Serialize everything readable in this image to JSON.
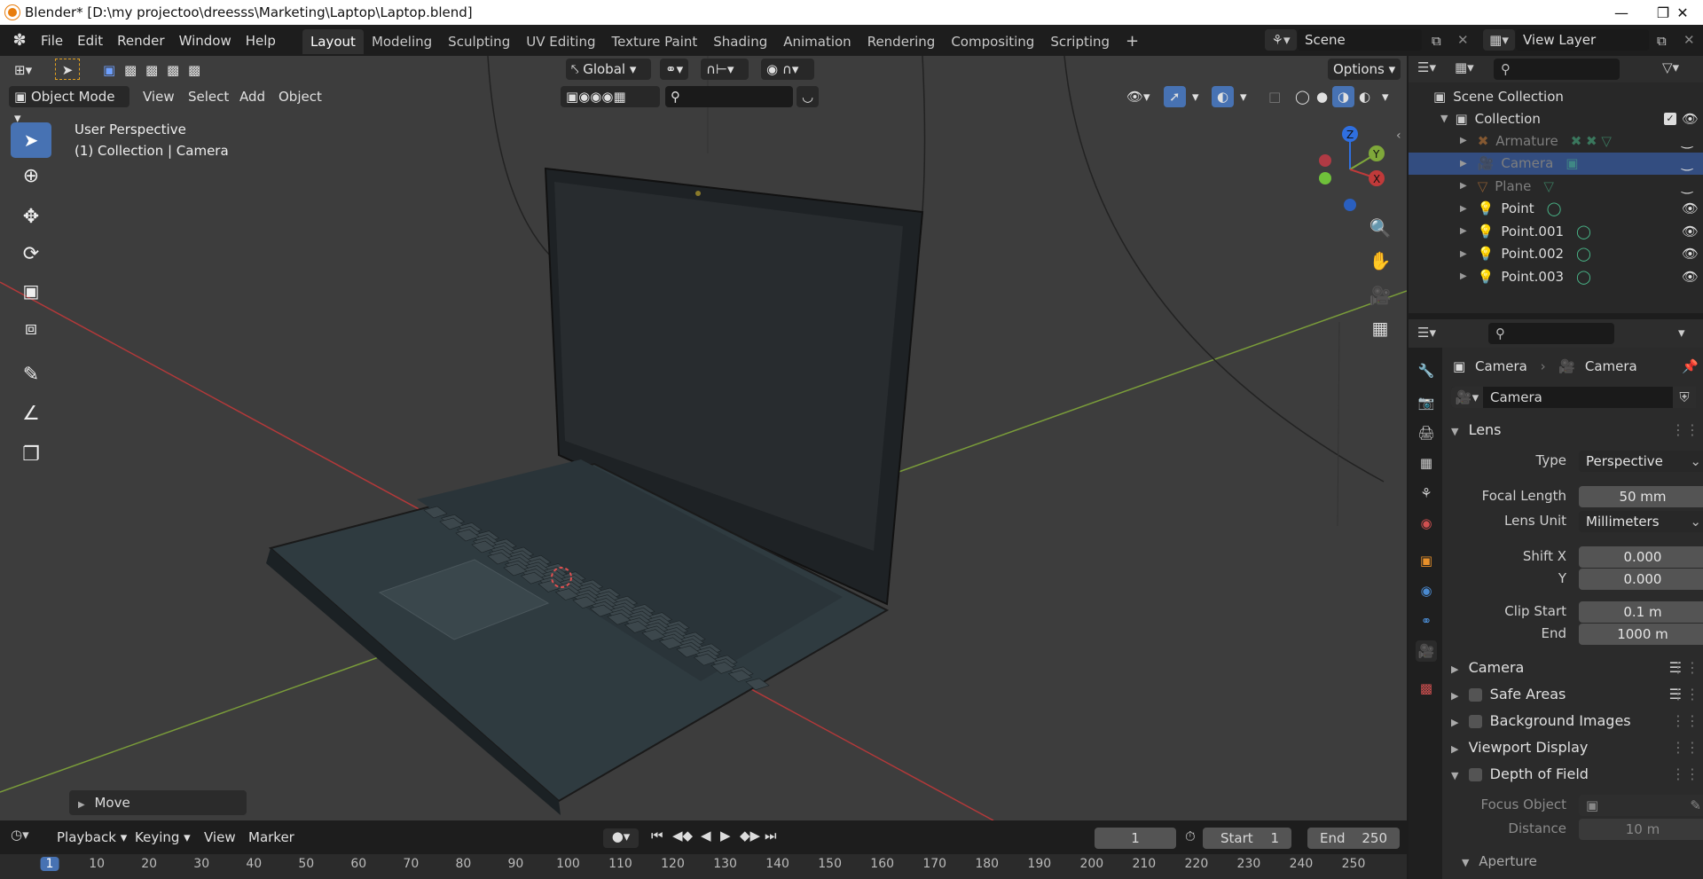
{
  "titlebar": {
    "title": "Blender* [D:\\my projectoo\\dreesss\\Marketing\\Laptop\\Laptop.blend]"
  },
  "menu": [
    "File",
    "Edit",
    "Render",
    "Window",
    "Help"
  ],
  "workspaces": [
    "Layout",
    "Modeling",
    "Sculpting",
    "UV Editing",
    "Texture Paint",
    "Shading",
    "Animation",
    "Rendering",
    "Compositing",
    "Scripting"
  ],
  "scene": {
    "name": "Scene",
    "view_layer": "View Layer"
  },
  "viewport": {
    "transform_orientation": "Global",
    "options_label": "Options",
    "mode": "Object Mode",
    "header_menus": [
      "View",
      "Select",
      "Add",
      "Object"
    ],
    "overlay_text_1": "User Perspective",
    "overlay_text_2": "(1) Collection | Camera",
    "last_op": "Move",
    "gizmo": {
      "z": "Z",
      "y": "Y",
      "x": "X"
    }
  },
  "outliner": {
    "scene_collection": "Scene Collection",
    "collection": "Collection",
    "items": [
      {
        "name": "Armature",
        "dim": true,
        "selected": false
      },
      {
        "name": "Camera",
        "dim": true,
        "selected": true
      },
      {
        "name": "Plane",
        "dim": true,
        "selected": false
      },
      {
        "name": "Point",
        "dim": false,
        "selected": false
      },
      {
        "name": "Point.001",
        "dim": false,
        "selected": false
      },
      {
        "name": "Point.002",
        "dim": false,
        "selected": false
      },
      {
        "name": "Point.003",
        "dim": false,
        "selected": false
      }
    ]
  },
  "properties": {
    "breadcrumb_object": "Camera",
    "breadcrumb_data": "Camera",
    "datablock": "Camera",
    "lens_section": "Lens",
    "type_label": "Type",
    "type_value": "Perspective",
    "focal_label": "Focal Length",
    "focal_value": "50 mm",
    "lens_unit_label": "Lens Unit",
    "lens_unit_value": "Millimeters",
    "shift_x_label": "Shift X",
    "shift_x_value": "0.000",
    "shift_y_label": "Y",
    "shift_y_value": "0.000",
    "clip_start_label": "Clip Start",
    "clip_start_value": "0.1 m",
    "clip_end_label": "End",
    "clip_end_value": "1000 m",
    "sections": [
      "Camera",
      "Safe Areas",
      "Background Images",
      "Viewport Display",
      "Depth of Field"
    ],
    "focus_object_label": "Focus Object",
    "distance_label": "Distance",
    "distance_value": "10 m",
    "aperture_label": "Aperture"
  },
  "timeline": {
    "menus": [
      "Playback",
      "Keying",
      "View",
      "Marker"
    ],
    "current_frame": "1",
    "start_label": "Start",
    "start_value": "1",
    "end_label": "End",
    "end_value": "250",
    "ticks": [
      "1",
      "10",
      "20",
      "30",
      "40",
      "50",
      "60",
      "70",
      "80",
      "90",
      "100",
      "110",
      "120",
      "130",
      "140",
      "150",
      "160",
      "170",
      "180",
      "190",
      "200",
      "210",
      "220",
      "230",
      "240",
      "250"
    ]
  },
  "colors": {
    "accent": "#4772b3",
    "x_axis": "#c03a3a",
    "y_axis": "#7fa83a",
    "z_axis": "#2f6fe0"
  }
}
